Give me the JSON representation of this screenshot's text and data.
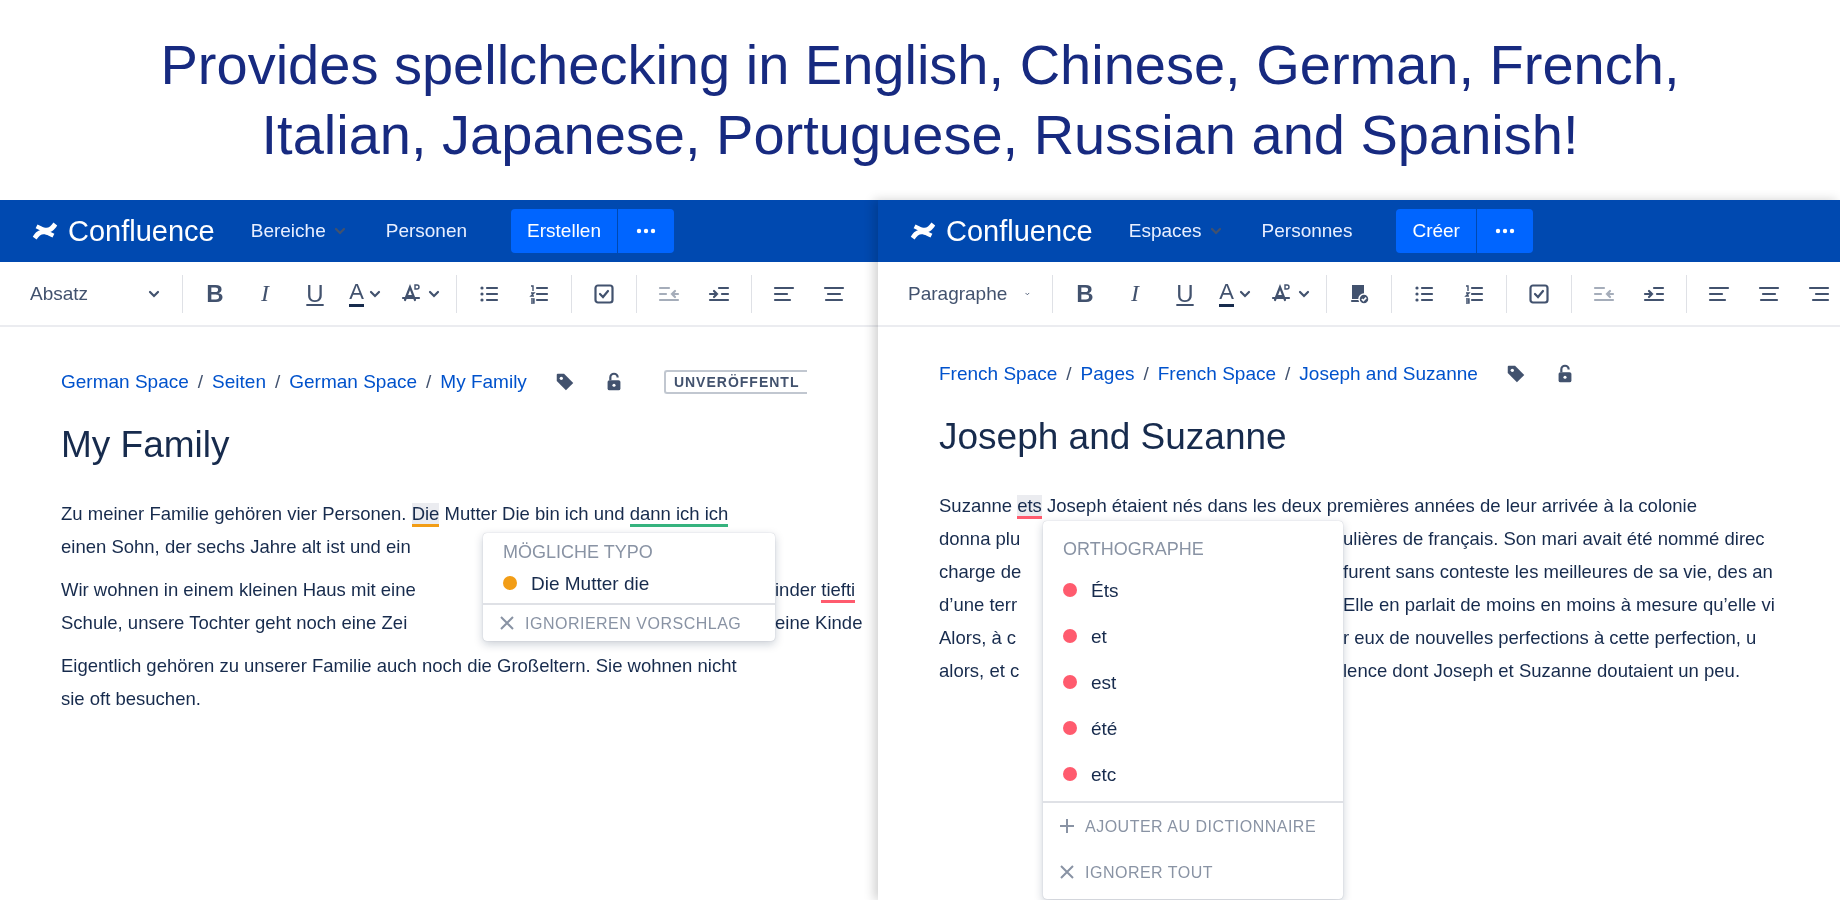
{
  "banner": {
    "text": "Provides spellchecking in English, Chinese, German, French, Italian, Japanese, Portuguese, Russian and Spanish!"
  },
  "panels": [
    {
      "nav": {
        "logo": "Confluence",
        "items": [
          {
            "kind": "menu",
            "label": "Bereiche"
          },
          {
            "kind": "link",
            "label": "Personen"
          }
        ],
        "create_button": "Erstellen"
      },
      "toolbar": {
        "groups": [
          [
            {
              "kind": "select",
              "label": "Absatz"
            }
          ],
          [
            {
              "kind": "bold",
              "text": "B",
              "disabled": false
            },
            {
              "kind": "italic",
              "text": "I",
              "disabled": false
            },
            {
              "kind": "underline",
              "text": "U",
              "disabled": false
            },
            {
              "kind": "text-color",
              "text": "A",
              "disabled": false
            },
            {
              "kind": "clear-format",
              "disabled": false
            }
          ],
          [
            {
              "kind": "bullet-list",
              "disabled": false
            },
            {
              "kind": "number-list",
              "disabled": false
            }
          ],
          [
            {
              "kind": "task",
              "disabled": false
            }
          ],
          [
            {
              "kind": "outdent",
              "disabled": true
            },
            {
              "kind": "indent",
              "disabled": false
            }
          ],
          [
            {
              "kind": "align-left",
              "disabled": false
            },
            {
              "kind": "align-center",
              "disabled": false
            }
          ]
        ]
      },
      "breadcrumb": [
        {
          "kind": "link",
          "text": "German Space"
        },
        {
          "kind": "separator",
          "text": "/"
        },
        {
          "kind": "link",
          "text": "Seiten"
        },
        {
          "kind": "separator",
          "text": "/"
        },
        {
          "kind": "link",
          "text": "German Space"
        },
        {
          "kind": "separator",
          "text": "/"
        },
        {
          "kind": "link",
          "text": "My Family"
        }
      ],
      "status_badge": "UNVERÖFFENTL",
      "title": "My Family",
      "paragraphs": [
        {
          "lines": [
            {
              "left": [
                "Zu meiner Familie gehören vier Personen. ",
                {
                  "text": "Die",
                  "color": "#f29d16",
                  "selected": true
                },
                " Mutter Die bin ich und ",
                {
                  "text": "dann ich ich",
                  "color": "#36b37e",
                  "selected": false
                }
              ]
            },
            {
              "left": [
                "einen Sohn, der sechs Jahre alt ist und ein"
              ]
            }
          ]
        },
        {
          "lines": [
            {
              "left": [
                "Wir wohnen in einem kleinen Haus mit eine"
              ],
              "right": [
                "inder ",
                {
                  "text": "tiefti",
                  "color": "#ff5b6e",
                  "selected": false
                }
              ]
            },
            {
              "left": [
                "Schule, unsere Tochter geht noch eine Zei"
              ],
              "right": [
                "eine Kinde"
              ]
            }
          ]
        },
        {
          "lines": [
            {
              "left": [
                "Eigentlich gehören zu unserer Familie auch noch die Großeltern. Sie wohnen nicht"
              ]
            },
            {
              "left": [
                "sie oft besuchen."
              ]
            }
          ]
        }
      ],
      "popup": {
        "heading": "MÖGLICHE TYPO",
        "suggestions": [
          {
            "text": "Die Mutter die",
            "color": "#f29d16"
          }
        ],
        "actions": [
          {
            "kind": "ignore",
            "label": "IGNORIEREN VORSCHLAG"
          }
        ]
      }
    },
    {
      "nav": {
        "logo": "Confluence",
        "items": [
          {
            "kind": "menu",
            "label": "Espaces"
          },
          {
            "kind": "link",
            "label": "Personnes"
          }
        ],
        "create_button": "Créer"
      },
      "toolbar": {
        "groups": [
          [
            {
              "kind": "select",
              "label": "Paragraphe"
            }
          ],
          [
            {
              "kind": "bold",
              "text": "B",
              "disabled": false
            },
            {
              "kind": "italic",
              "text": "I",
              "disabled": false
            },
            {
              "kind": "underline",
              "text": "U",
              "disabled": false
            },
            {
              "kind": "text-color",
              "text": "A",
              "disabled": false
            },
            {
              "kind": "clear-format",
              "disabled": false
            }
          ],
          [
            {
              "kind": "macro",
              "disabled": false
            }
          ],
          [
            {
              "kind": "bullet-list",
              "disabled": false
            },
            {
              "kind": "number-list",
              "disabled": false
            }
          ],
          [
            {
              "kind": "task",
              "disabled": false
            }
          ],
          [
            {
              "kind": "outdent",
              "disabled": true
            },
            {
              "kind": "indent",
              "disabled": false
            }
          ],
          [
            {
              "kind": "align-left",
              "disabled": false
            },
            {
              "kind": "align-center",
              "disabled": false
            },
            {
              "kind": "align-right",
              "disabled": false
            }
          ]
        ]
      },
      "breadcrumb": [
        {
          "kind": "link",
          "text": "French Space"
        },
        {
          "kind": "separator",
          "text": "/"
        },
        {
          "kind": "link",
          "text": "Pages"
        },
        {
          "kind": "separator",
          "text": "/"
        },
        {
          "kind": "link",
          "text": "French Space"
        },
        {
          "kind": "separator",
          "text": "/"
        },
        {
          "kind": "link",
          "text": "Joseph and Suzanne"
        }
      ],
      "title": "Joseph and Suzanne",
      "paragraphs": [
        {
          "lines": [
            {
              "left": [
                "Suzanne ",
                {
                  "text": "ets",
                  "color": "#ff5b6e",
                  "selected": true
                },
                " Joseph étaient nés dans les deux premières années de leur arrivée à la colonie"
              ]
            },
            {
              "left": [
                "donna plu"
              ],
              "right": [
                "ulières de français. Son mari avait été nommé direc"
              ]
            },
            {
              "left": [
                "charge de"
              ],
              "right": [
                "furent sans conteste les meilleures de sa vie, des an"
              ]
            },
            {
              "left": [
                "d’une terr"
              ],
              "right": [
                "Elle en parlait de moins en moins à mesure qu’elle vi"
              ]
            },
            {
              "left": [
                "Alors, à c"
              ],
              "right": [
                "r eux de nouvelles perfections à cette perfection, u"
              ]
            },
            {
              "left": [
                "alors, et c"
              ],
              "right": [
                "lence dont Joseph et Suzanne doutaient un peu."
              ]
            }
          ]
        }
      ],
      "popup": {
        "heading": "ORTHOGRAPHE",
        "suggestions": [
          {
            "text": "Éts",
            "color": "#ff5b6e"
          },
          {
            "text": "et",
            "color": "#ff5b6e"
          },
          {
            "text": "est",
            "color": "#ff5b6e"
          },
          {
            "text": "été",
            "color": "#ff5b6e"
          },
          {
            "text": "etc",
            "color": "#ff5b6e"
          }
        ],
        "actions": [
          {
            "kind": "add",
            "label": "AJOUTER AU DICTIONNAIRE"
          },
          {
            "kind": "ignore",
            "label": "IGNORER TOUT"
          }
        ]
      }
    }
  ]
}
